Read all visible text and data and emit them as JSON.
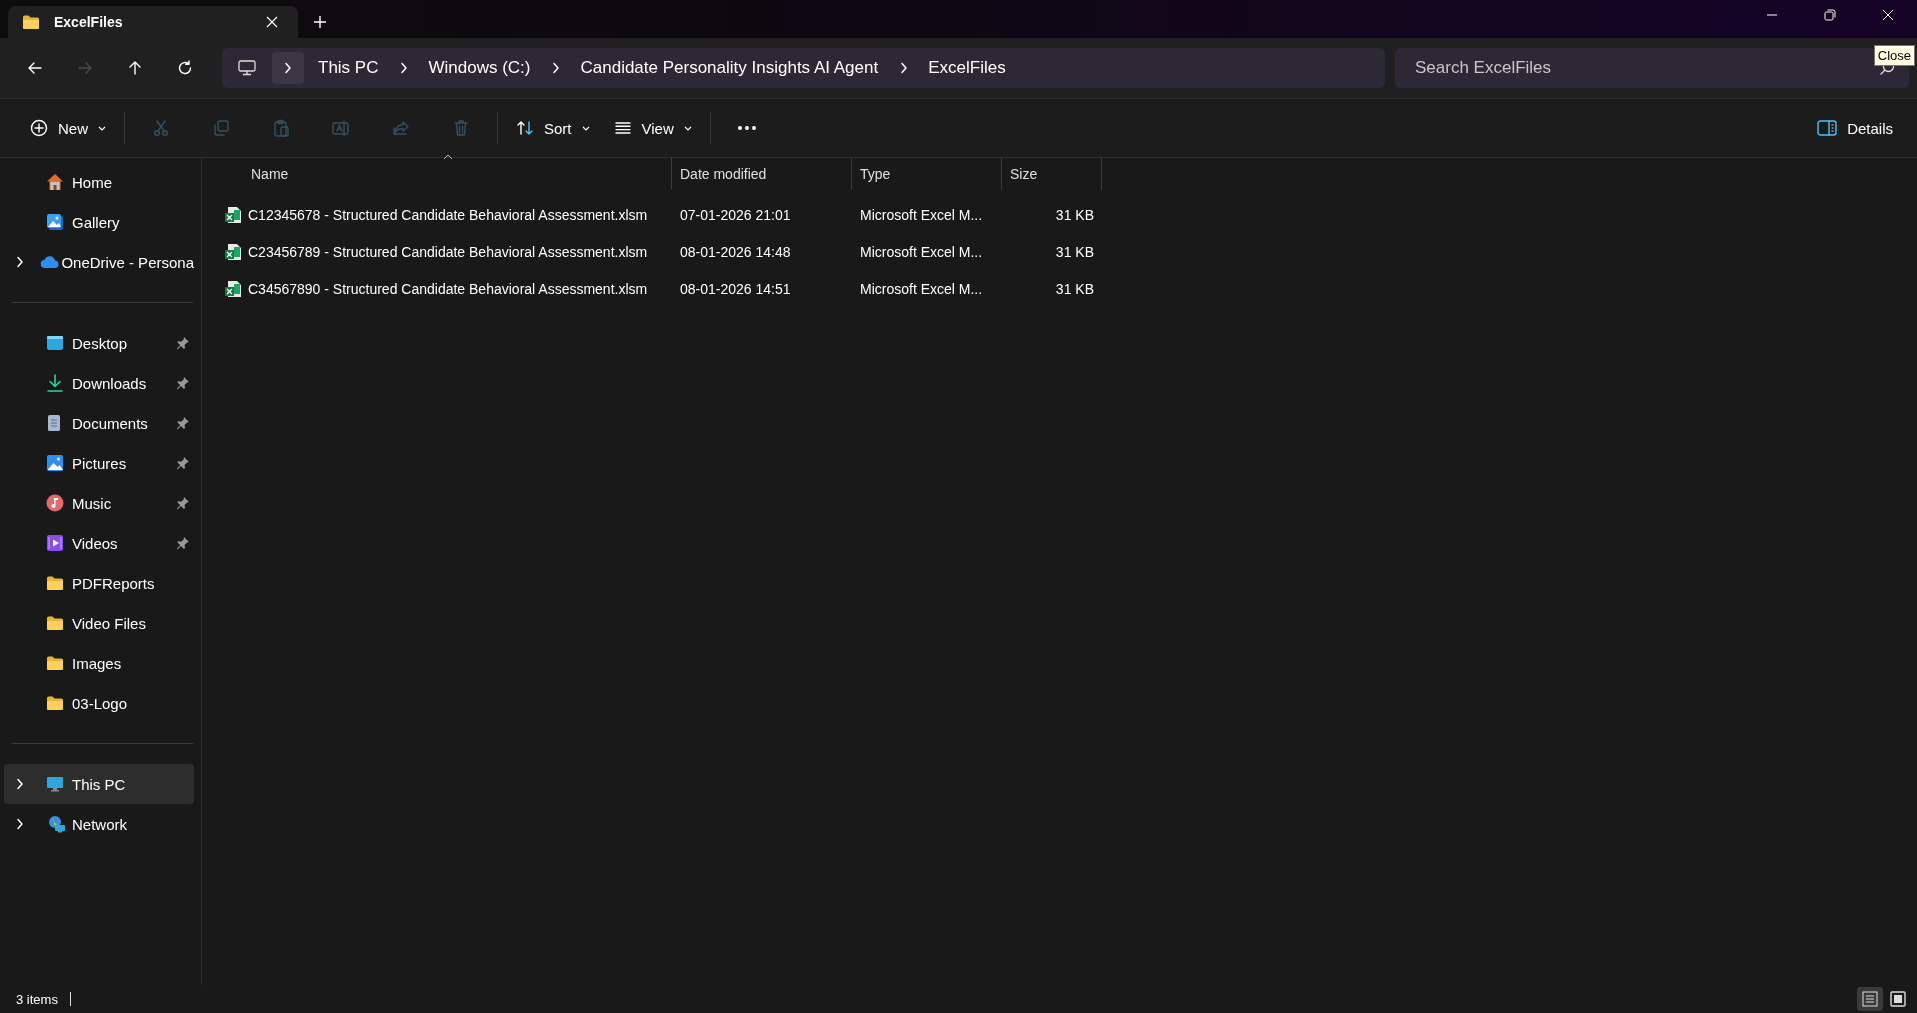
{
  "window": {
    "tab": {
      "title": "ExcelFiles",
      "selected": true
    },
    "controls": [
      {
        "kind": "minimize"
      },
      {
        "kind": "restore"
      },
      {
        "kind": "close"
      }
    ],
    "tooltip": "Close"
  },
  "navigation": [
    {
      "kind": "back",
      "disabled": false
    },
    {
      "kind": "forward",
      "disabled": true
    },
    {
      "kind": "up",
      "disabled": false
    },
    {
      "kind": "refresh",
      "disabled": false
    }
  ],
  "breadcrumbs": [
    "This PC",
    "Windows (C:)",
    "Candidate Personality Insights AI Agent",
    "ExcelFiles"
  ],
  "search": {
    "placeholder": "Search ExcelFiles"
  },
  "toolbar": [
    {
      "kind": "new",
      "label": "New",
      "disabled": false
    },
    {
      "kind": "cut",
      "disabled": true
    },
    {
      "kind": "copy",
      "disabled": true
    },
    {
      "kind": "paste",
      "disabled": true
    },
    {
      "kind": "rename",
      "disabled": true
    },
    {
      "kind": "share",
      "disabled": true
    },
    {
      "kind": "delete",
      "disabled": true
    },
    {
      "kind": "sort",
      "label": "Sort",
      "disabled": false
    },
    {
      "kind": "view",
      "label": "View",
      "disabled": false
    },
    {
      "kind": "more",
      "disabled": false
    }
  ],
  "details_button": {
    "label": "Details"
  },
  "sidebar": {
    "groups": [
      [
        {
          "label": "Home",
          "selected": false
        },
        {
          "label": "Gallery",
          "selected": false
        },
        {
          "label": "OneDrive - Persona",
          "expanded": false,
          "selected": false
        }
      ],
      [
        {
          "label": "Desktop",
          "pinned": true,
          "selected": false
        },
        {
          "label": "Downloads",
          "pinned": true,
          "selected": false
        },
        {
          "label": "Documents",
          "pinned": true,
          "selected": false
        },
        {
          "label": "Pictures",
          "pinned": true,
          "selected": false
        },
        {
          "label": "Music",
          "pinned": true,
          "selected": false
        },
        {
          "label": "Videos",
          "pinned": true,
          "selected": false
        },
        {
          "label": "PDFReports",
          "pinned": false,
          "selected": false
        },
        {
          "label": "Video Files",
          "pinned": false,
          "selected": false
        },
        {
          "label": "Images",
          "pinned": false,
          "selected": false
        },
        {
          "label": "03-Logo",
          "pinned": false,
          "selected": false
        }
      ],
      [
        {
          "label": "This PC",
          "expanded": false,
          "selected": true
        },
        {
          "label": "Network",
          "expanded": false,
          "selected": false
        }
      ]
    ]
  },
  "table": {
    "columns": [
      {
        "label": "Name",
        "sorted": true
      },
      {
        "label": "Date modified",
        "sorted": false
      },
      {
        "label": "Type",
        "sorted": false
      },
      {
        "label": "Size",
        "sorted": false
      }
    ],
    "rows": [
      {
        "name": "C12345678 - Structured Candidate Behavioral Assessment.xlsm",
        "date": "07-01-2026 21:01",
        "type": "Microsoft Excel M...",
        "size": "31 KB",
        "selected": false
      },
      {
        "name": "C23456789 - Structured Candidate Behavioral Assessment.xlsm",
        "date": "08-01-2026 14:48",
        "type": "Microsoft Excel M...",
        "size": "31 KB",
        "selected": false
      },
      {
        "name": "C34567890 - Structured Candidate Behavioral Assessment.xlsm",
        "date": "08-01-2026 14:51",
        "type": "Microsoft Excel M...",
        "size": "31 KB",
        "selected": false
      }
    ]
  },
  "status_bar": {
    "text": "3 items",
    "views": [
      {
        "kind": "details",
        "selected": true
      },
      {
        "kind": "tiles",
        "selected": false
      }
    ]
  }
}
